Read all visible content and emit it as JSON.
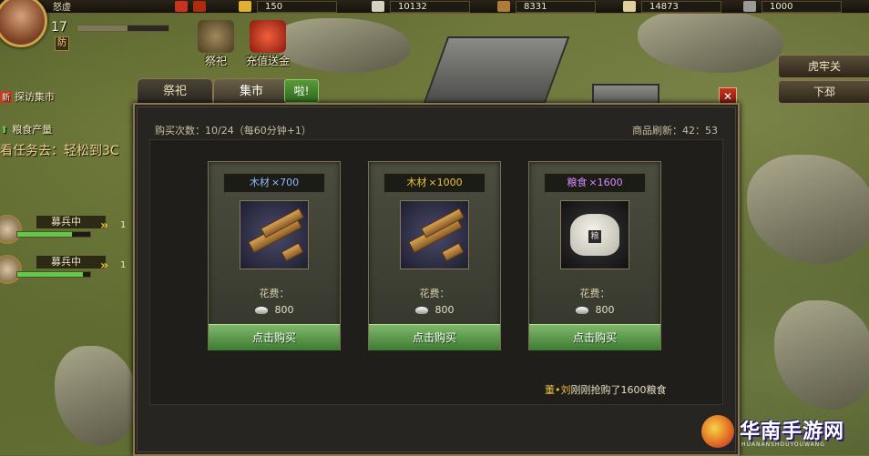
{
  "topbar": {
    "resources": [
      {
        "icon": "gold-chest-icon",
        "value": "150"
      },
      {
        "icon": "ingot-icon",
        "value": "10132"
      },
      {
        "icon": "wood-icon",
        "value": "8331"
      },
      {
        "icon": "grain-sack-icon",
        "value": "14873"
      },
      {
        "icon": "soldiers-icon",
        "value": "1000"
      }
    ]
  },
  "player": {
    "name": "怒虚",
    "level": "17",
    "level_progress": 0.55,
    "badge": "防"
  },
  "shortcuts": {
    "sacrifice": "祭祀",
    "recharge_gift": "充值送金"
  },
  "quests": {
    "new_tag": "新",
    "visit_market": "探访集市",
    "grain_output": "粮食产量",
    "hint": "看任务去：轻松到3C"
  },
  "troops": [
    {
      "status": "募兵中",
      "progress": 0.75,
      "count": "1"
    },
    {
      "status": "募兵中",
      "progress": 0.9,
      "count": "1"
    }
  ],
  "map_buttons": {
    "hulao": "虎牢关",
    "xiapi": "下邳"
  },
  "tabs": {
    "sacrifice": "祭祀",
    "market": "集市",
    "notice": "啦!"
  },
  "market": {
    "buy_count": "购买次数：10/24（每60分钟+1）",
    "refresh": "商品刷新：42：53",
    "cost_label": "花费：",
    "buy_button": "点击购买",
    "items": [
      {
        "name": "木材",
        "qty": "×700",
        "cost": "800",
        "name_color": "#8fb8ff",
        "icon": "wood-planks-icon"
      },
      {
        "name": "木材",
        "qty": "×1000",
        "cost": "800",
        "name_color": "#f0c23a",
        "icon": "wood-planks-icon"
      },
      {
        "name": "粮食",
        "qty": "×1600",
        "cost": "800",
        "name_color": "#d88aff",
        "icon": "grain-bag-icon"
      }
    ],
    "log_who": "董•刘",
    "log_text": "刚刚抢购了1600粮食"
  },
  "watermark": {
    "name": "华南手游网",
    "sub": "HUANANSHOUYOUWANG"
  }
}
